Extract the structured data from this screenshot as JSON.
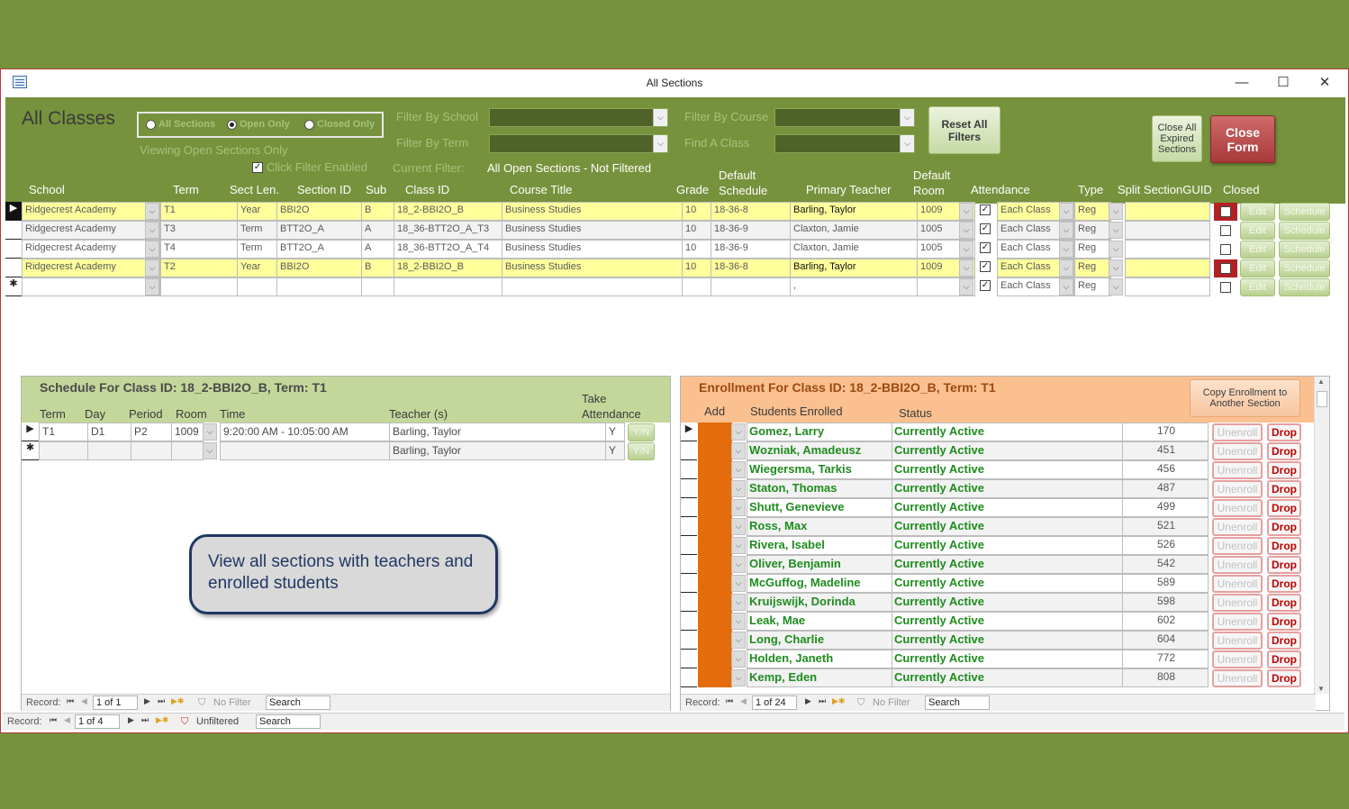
{
  "window": {
    "title": "All Sections",
    "controls": {
      "minimize": "—",
      "maximize": "☐",
      "close": "✕"
    }
  },
  "header": {
    "form_title": "All Classes",
    "view_options": [
      {
        "label": "All Sections",
        "selected": false
      },
      {
        "label": "Open Only",
        "selected": true
      },
      {
        "label": "Closed Only",
        "selected": false
      }
    ],
    "viewing_text": "Viewing Open Sections Only",
    "click_filter": {
      "label": "Click Filter Enabled",
      "checked": true
    },
    "filters": {
      "school_label": "Filter By School",
      "term_label": "Filter By Term",
      "course_label": "Filter By Course",
      "find_label": "Find A Class",
      "school_value": "",
      "term_value": "",
      "course_value": "",
      "find_value": ""
    },
    "current_filter_label": "Current Filter:",
    "current_filter_value": "All Open Sections - Not Filtered",
    "reset_button": "Reset All Filters",
    "close_expired_button": "Close All Expired Sections",
    "close_form_button": "Close Form"
  },
  "sections_table": {
    "columns": [
      "School",
      "Term",
      "Sect Len.",
      "Section ID",
      "Sub",
      "Class ID",
      "Course Title",
      "Grade",
      "Default Schedule",
      "Primary Teacher",
      "Default Room",
      "Attendance",
      "Type",
      "Split SectionGUID",
      "Closed"
    ],
    "rows": [
      {
        "school": "Ridgecrest Academy",
        "term": "T1",
        "sect_len": "Year",
        "section_id": "BBI2O",
        "sub": "B",
        "class_id": "18_2-BBI2O_B",
        "course_title": "Business Studies",
        "grade": "10",
        "schedule": "18-36-8",
        "teacher": "Barling, Taylor",
        "room": "1009",
        "attendance_checked": true,
        "attendance": "Each Class",
        "type": "Reg",
        "split_guid": "",
        "closed": false,
        "highlight": "yellow",
        "current": true
      },
      {
        "school": "Ridgecrest Academy",
        "term": "T3",
        "sect_len": "Term",
        "section_id": "BTT2O_A",
        "sub": "A",
        "class_id": "18_36-BTT2O_A_T3",
        "course_title": "Business Studies",
        "grade": "10",
        "schedule": "18-36-9",
        "teacher": "Claxton, Jamie",
        "room": "1005",
        "attendance_checked": true,
        "attendance": "Each Class",
        "type": "Reg",
        "split_guid": "",
        "closed": false,
        "highlight": "gray",
        "current": false
      },
      {
        "school": "Ridgecrest Academy",
        "term": "T4",
        "sect_len": "Term",
        "section_id": "BTT2O_A",
        "sub": "A",
        "class_id": "18_36-BTT2O_A_T4",
        "course_title": "Business Studies",
        "grade": "10",
        "schedule": "18-36-9",
        "teacher": "Claxton, Jamie",
        "room": "1005",
        "attendance_checked": true,
        "attendance": "Each Class",
        "type": "Reg",
        "split_guid": "",
        "closed": false,
        "highlight": "white",
        "current": false
      },
      {
        "school": "Ridgecrest Academy",
        "term": "T2",
        "sect_len": "Year",
        "section_id": "BBI2O",
        "sub": "B",
        "class_id": "18_2-BBI2O_B",
        "course_title": "Business Studies",
        "grade": "10",
        "schedule": "18-36-8",
        "teacher": "Barling, Taylor",
        "room": "1009",
        "attendance_checked": true,
        "attendance": "Each Class",
        "type": "Reg",
        "split_guid": "",
        "closed": false,
        "highlight": "yellow",
        "current": false
      }
    ],
    "new_row": {
      "teacher": ",",
      "attendance": "Each Class",
      "type": "Reg"
    },
    "edit_label": "Edit",
    "schedule_label": "Schedule",
    "new_record_marker": "✱",
    "record_nav": {
      "label": "Record:",
      "position": "1 of 4",
      "filter": "Unfiltered",
      "search": "Search"
    }
  },
  "schedule": {
    "title": "Schedule For Class ID: 18_2-BBI2O_B, Term: T1",
    "columns": [
      "Term",
      "Day",
      "Period",
      "Room",
      "Time",
      "Teacher (s)",
      "Take Attendance"
    ],
    "rows": [
      {
        "term": "T1",
        "day": "D1",
        "period": "P2",
        "room": "1009",
        "time": "9:20:00 AM - 10:05:00 AM",
        "teacher": "Barling, Taylor",
        "take_attendance": "Y"
      }
    ],
    "new_row": {
      "teacher": "Barling, Taylor",
      "take_attendance": "Y"
    },
    "yn_label": "Y/N",
    "record_nav": {
      "label": "Record:",
      "position": "1 of 1",
      "filter": "No Filter",
      "search": "Search"
    }
  },
  "callout": {
    "text": "View all sections with teachers and enrolled students"
  },
  "enrollment": {
    "title": "Enrollment For Class ID: 18_2-BBI2O_B, Term: T1",
    "copy_button": "Copy Enrollment to Another Section",
    "columns": [
      "Add",
      "Students Enrolled",
      "Status"
    ],
    "rows": [
      {
        "student": "Gomez, Larry",
        "status": "Currently Active",
        "id": "170"
      },
      {
        "student": "Wozniak, Amadeusz",
        "status": "Currently Active",
        "id": "451"
      },
      {
        "student": "Wiegersma, Tarkis",
        "status": "Currently Active",
        "id": "456"
      },
      {
        "student": "Staton, Thomas",
        "status": "Currently Active",
        "id": "487"
      },
      {
        "student": "Shutt, Genevieve",
        "status": "Currently Active",
        "id": "499"
      },
      {
        "student": "Ross, Max",
        "status": "Currently Active",
        "id": "521"
      },
      {
        "student": "Rivera, Isabel",
        "status": "Currently Active",
        "id": "526"
      },
      {
        "student": "Oliver, Benjamin",
        "status": "Currently Active",
        "id": "542"
      },
      {
        "student": "McGuffog, Madeline",
        "status": "Currently Active",
        "id": "589"
      },
      {
        "student": "Kruijswijk, Dorinda",
        "status": "Currently Active",
        "id": "598"
      },
      {
        "student": "Leak, Mae",
        "status": "Currently Active",
        "id": "602"
      },
      {
        "student": "Long, Charlie",
        "status": "Currently Active",
        "id": "604"
      },
      {
        "student": "Holden, Janeth",
        "status": "Currently Active",
        "id": "772"
      },
      {
        "student": "Kemp, Eden",
        "status": "Currently Active",
        "id": "808"
      }
    ],
    "unenroll_label": "Unenroll",
    "drop_label": "Drop",
    "record_nav": {
      "label": "Record:",
      "position": "1 of 24",
      "filter": "No Filter",
      "search": "Search"
    }
  },
  "colors": {
    "header_green": "#76923c",
    "row_yellow": "#ffff9c",
    "schedule_header": "#c4d79b",
    "enrollment_header": "#fac090",
    "add_orange": "#e46c0a",
    "student_green": "#1e8c1e",
    "close_red": "#a83a3a"
  }
}
